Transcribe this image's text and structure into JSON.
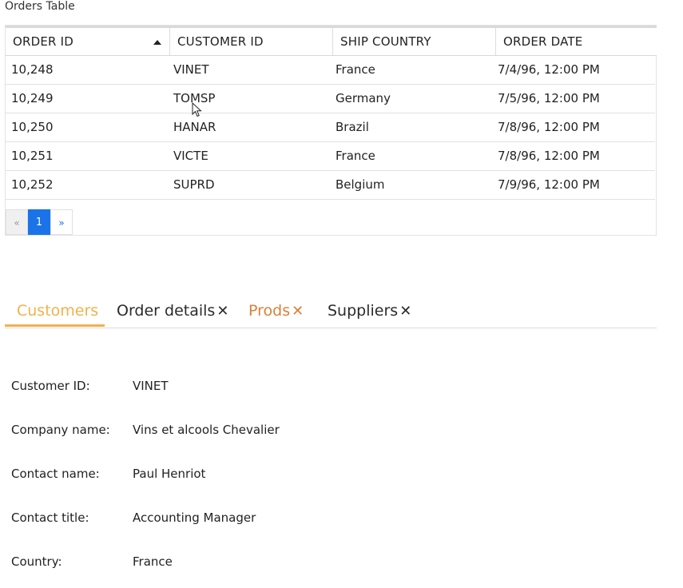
{
  "title": "Orders Table",
  "grid": {
    "columns": [
      {
        "label": "ORDER ID",
        "sorted": "ascending"
      },
      {
        "label": "CUSTOMER ID"
      },
      {
        "label": "SHIP COUNTRY"
      },
      {
        "label": "ORDER DATE"
      }
    ],
    "rows": [
      [
        "10,248",
        "VINET",
        "France",
        "7/4/96, 12:00 PM"
      ],
      [
        "10,249",
        "TOMSP",
        "Germany",
        "7/5/96, 12:00 PM"
      ],
      [
        "10,250",
        "HANAR",
        "Brazil",
        "7/8/96, 12:00 PM"
      ],
      [
        "10,251",
        "VICTE",
        "France",
        "7/8/96, 12:00 PM"
      ],
      [
        "10,252",
        "SUPRD",
        "Belgium",
        "7/9/96, 12:00 PM"
      ]
    ],
    "pager": {
      "prev": "«",
      "current": "1",
      "next": "»"
    }
  },
  "tabs": [
    {
      "label": "Customers",
      "closable": false,
      "active": true
    },
    {
      "label": "Order details",
      "closable": true
    },
    {
      "label": "Prods",
      "closable": true
    },
    {
      "label": "Suppliers",
      "closable": true
    }
  ],
  "close_glyph": "✕",
  "details": [
    {
      "label": "Customer ID:",
      "value": "VINET"
    },
    {
      "label": "Company name:",
      "value": "Vins et alcools Chevalier"
    },
    {
      "label": "Contact name:",
      "value": "Paul Henriot"
    },
    {
      "label": "Contact title:",
      "value": "Accounting Manager"
    },
    {
      "label": "Country:",
      "value": "France"
    }
  ],
  "colors": {
    "accent_blue": "#1a73e8",
    "active_tab": "#f0b24d",
    "prods_tab": "#d9803a"
  }
}
